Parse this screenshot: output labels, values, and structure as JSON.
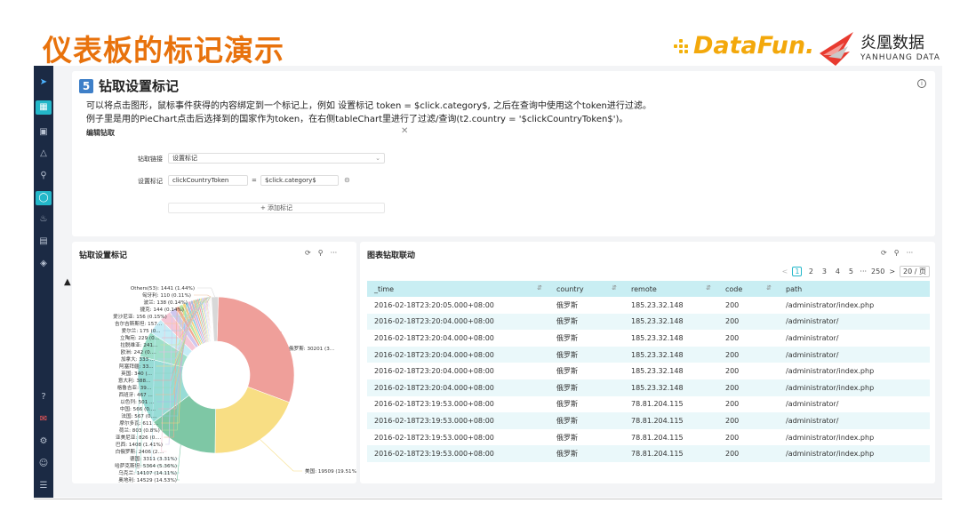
{
  "slide": {
    "title": "仪表板的标记演示",
    "logo_left": "DataFun.",
    "logo_right_name": "炎凰数据",
    "logo_right_sub": "YANHUANG DATA"
  },
  "colors": {
    "accent": "#23b7c9",
    "title": "#e8720c",
    "nav": "#1b2a44"
  },
  "sidenav": {
    "items": [
      "logo-icon",
      "dashboard-icon",
      "monitor-icon",
      "upload-icon",
      "search-icon",
      "history-icon",
      "bell-icon",
      "storage-icon",
      "layers-icon",
      "help-icon",
      "feedback-icon",
      "settings-icon",
      "user-icon",
      "menu-icon"
    ]
  },
  "section": {
    "number": "5",
    "title": "钻取设置标记",
    "desc1": "可以将点击图形，鼠标事件获得的内容绑定到一个标记上，例如 设置标记 token = $click.category$, 之后在查询中使用这个token进行过滤。",
    "desc2": "例子里是用的PieChart点击后选择到的国家作为token，在右侧tableChart里进行了过滤/查询(t2.country = '$clickCountryToken$')。"
  },
  "drill": {
    "title": "编辑钻取",
    "link_label": "钻取链接",
    "link_value": "设置标记",
    "set_label": "设置标记",
    "token_name": "clickCountryToken",
    "equals": "=",
    "token_value": "$click.category$",
    "add_label": "+ 添加标记"
  },
  "left_panel": {
    "title": "钻取设置标记"
  },
  "right_panel": {
    "title": "图表钻取联动"
  },
  "pager": {
    "pages": [
      "1",
      "2",
      "3",
      "4",
      "5"
    ],
    "ellipsis": "···",
    "last": "250",
    "size": "20 / 页"
  },
  "table": {
    "columns": [
      "_time",
      "country",
      "remote",
      "code",
      "path"
    ],
    "rows": [
      [
        "2016-02-18T23:20:05.000+08:00",
        "俄罗斯",
        "185.23.32.148",
        "200",
        "/administrator/index.php"
      ],
      [
        "2016-02-18T23:20:04.000+08:00",
        "俄罗斯",
        "185.23.32.148",
        "200",
        "/administrator/"
      ],
      [
        "2016-02-18T23:20:04.000+08:00",
        "俄罗斯",
        "185.23.32.148",
        "200",
        "/administrator/"
      ],
      [
        "2016-02-18T23:20:04.000+08:00",
        "俄罗斯",
        "185.23.32.148",
        "200",
        "/administrator/"
      ],
      [
        "2016-02-18T23:20:04.000+08:00",
        "俄罗斯",
        "185.23.32.148",
        "200",
        "/administrator/index.php"
      ],
      [
        "2016-02-18T23:20:04.000+08:00",
        "俄罗斯",
        "185.23.32.148",
        "200",
        "/administrator/index.php"
      ],
      [
        "2016-02-18T23:19:53.000+08:00",
        "俄罗斯",
        "78.81.204.115",
        "200",
        "/administrator/"
      ],
      [
        "2016-02-18T23:19:53.000+08:00",
        "俄罗斯",
        "78.81.204.115",
        "200",
        "/administrator/"
      ],
      [
        "2016-02-18T23:19:53.000+08:00",
        "俄罗斯",
        "78.81.204.115",
        "200",
        "/administrator/index.php"
      ],
      [
        "2016-02-18T23:19:53.000+08:00",
        "俄罗斯",
        "78.81.204.115",
        "200",
        "/administrator/index.php"
      ]
    ]
  },
  "chart_data": {
    "type": "pie",
    "donut": true,
    "title": "钻取设置标记",
    "slices": [
      {
        "label": "俄罗斯: 30201 (3...",
        "value": 30201,
        "color": "#ef9f9a"
      },
      {
        "label": "美国: 19509 (19.51%)",
        "value": 19509,
        "color": "#f8de84"
      },
      {
        "label": "奥地利: 14529 (14.53%)",
        "value": 14529,
        "color": "#7ec7a5"
      },
      {
        "label": "乌克兰: 14107 (14.11%)",
        "value": 14107,
        "color": "#97dcd6"
      },
      {
        "label": "哈萨克斯坦: 5364 (5.36%)",
        "value": 5364,
        "color": "#9fe0cb"
      },
      {
        "label": "德国: 3311 (3.31%)",
        "value": 3311,
        "color": "#c5ecf6"
      },
      {
        "label": "白俄罗斯: 2406 (2....",
        "value": 2406,
        "color": "#f6c7d6"
      },
      {
        "label": "巴西: 1408 (1.41%)",
        "value": 1408,
        "color": "#cfc7ef"
      },
      {
        "label": "亚美尼亚: 826 (0....",
        "value": 826,
        "color": "#f2a98f"
      },
      {
        "label": "荷兰: 803 (0.8%)",
        "value": 803,
        "color": "#b9e7a2"
      },
      {
        "label": "摩尔多瓦: 611 ...",
        "value": 611,
        "color": "#f8d37a"
      },
      {
        "label": "法国: 567 (0....",
        "value": 567,
        "color": "#89cfe0"
      },
      {
        "label": "中国: 566 (0....",
        "value": 566,
        "color": "#e9a9c7"
      },
      {
        "label": "以色列: 501 ...",
        "value": 501,
        "color": "#a7b6ee"
      },
      {
        "label": "西班牙: 467 ...",
        "value": 467,
        "color": "#f0b98c"
      },
      {
        "label": "格鲁吉亚: 39...",
        "value": 390,
        "color": "#98d9b6"
      },
      {
        "label": "意大利: 388...",
        "value": 388,
        "color": "#f59f9f"
      },
      {
        "label": "英国: 340 (...",
        "value": 340,
        "color": "#8fd0c2"
      },
      {
        "label": "阿塞拜疆: 33...",
        "value": 330,
        "color": "#f3e08a"
      },
      {
        "label": "加拿大: 333 ...",
        "value": 333,
        "color": "#b5d1f3"
      },
      {
        "label": "欧洲: 242 (0....",
        "value": 242,
        "color": "#ecb5ee"
      },
      {
        "label": "拉脱维亚: 241...",
        "value": 241,
        "color": "#c8e89a"
      },
      {
        "label": "立陶宛: 229 (0...",
        "value": 229,
        "color": "#f4a3b7"
      },
      {
        "label": "爱尔兰: 175 (0...",
        "value": 175,
        "color": "#9dcbe9"
      },
      {
        "label": "吉尔吉斯斯坦: 157...",
        "value": 157,
        "color": "#f5c98f"
      },
      {
        "label": "爱沙尼亚: 156 (0.15%)",
        "value": 156,
        "color": "#a7e3c9"
      },
      {
        "label": "捷克: 144 (0.14%)",
        "value": 144,
        "color": "#e3b0dc"
      },
      {
        "label": "波兰: 138 (0.14%)",
        "value": 138,
        "color": "#c1d8a4"
      },
      {
        "label": "匈牙利: 110 (0.11%)",
        "value": 110,
        "color": "#f0c2a6"
      },
      {
        "label": "Others(53): 1441 (1.44%)",
        "value": 1441,
        "color": "#d8d8d8"
      }
    ]
  }
}
